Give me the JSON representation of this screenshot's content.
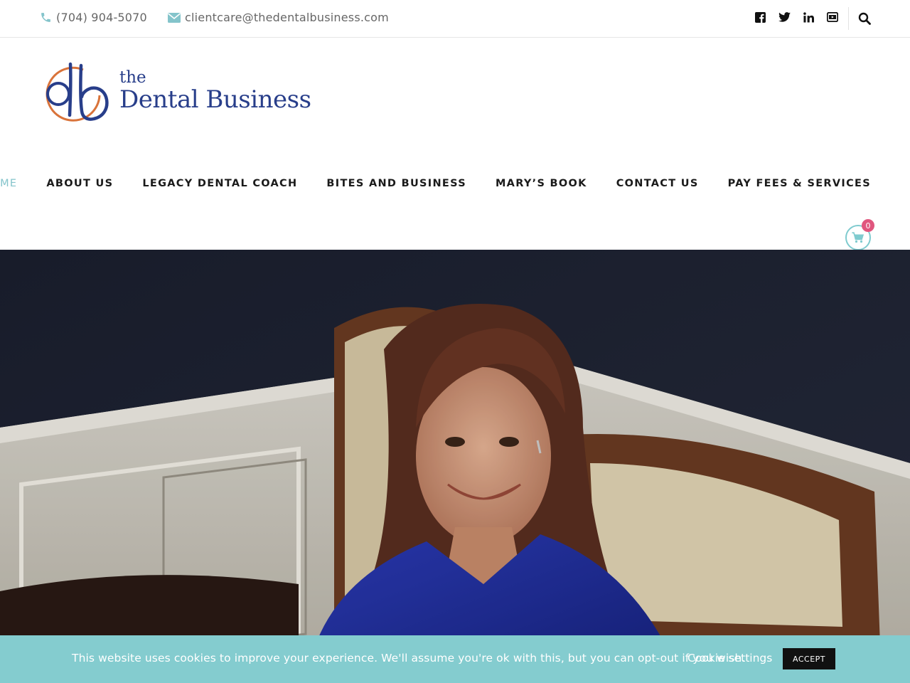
{
  "topbar": {
    "phone": "(704) 904-5070",
    "email": "clientcare@thedentalbusiness.com",
    "social_icons": [
      "facebook-icon",
      "twitter-icon",
      "linkedin-icon",
      "youtube-icon"
    ],
    "accent_color": "#84c4cb"
  },
  "logo": {
    "mark": "db",
    "the": "the",
    "name": "Dental Business",
    "brand_color": "#283e8a",
    "ring_color": "#d9733a"
  },
  "nav": {
    "items": [
      {
        "label": "HOME",
        "active": true
      },
      {
        "label": "ABOUT US"
      },
      {
        "label": "LEGACY DENTAL COACH"
      },
      {
        "label": "BITES AND BUSINESS"
      },
      {
        "label": "MARY’S BOOK"
      },
      {
        "label": "CONTACT US"
      },
      {
        "label": "PAY FEES & SERVICES"
      }
    ]
  },
  "cart": {
    "count": "0"
  },
  "hero": {
    "image": "portrait-photo"
  },
  "cookie": {
    "text": "This website uses cookies to improve your experience. We'll assume you're ok with this, but you can opt-out if you wish.",
    "settings_label": "Cookie settings",
    "accept_label": "ACCEPT",
    "bar_color": "#84cccf"
  }
}
